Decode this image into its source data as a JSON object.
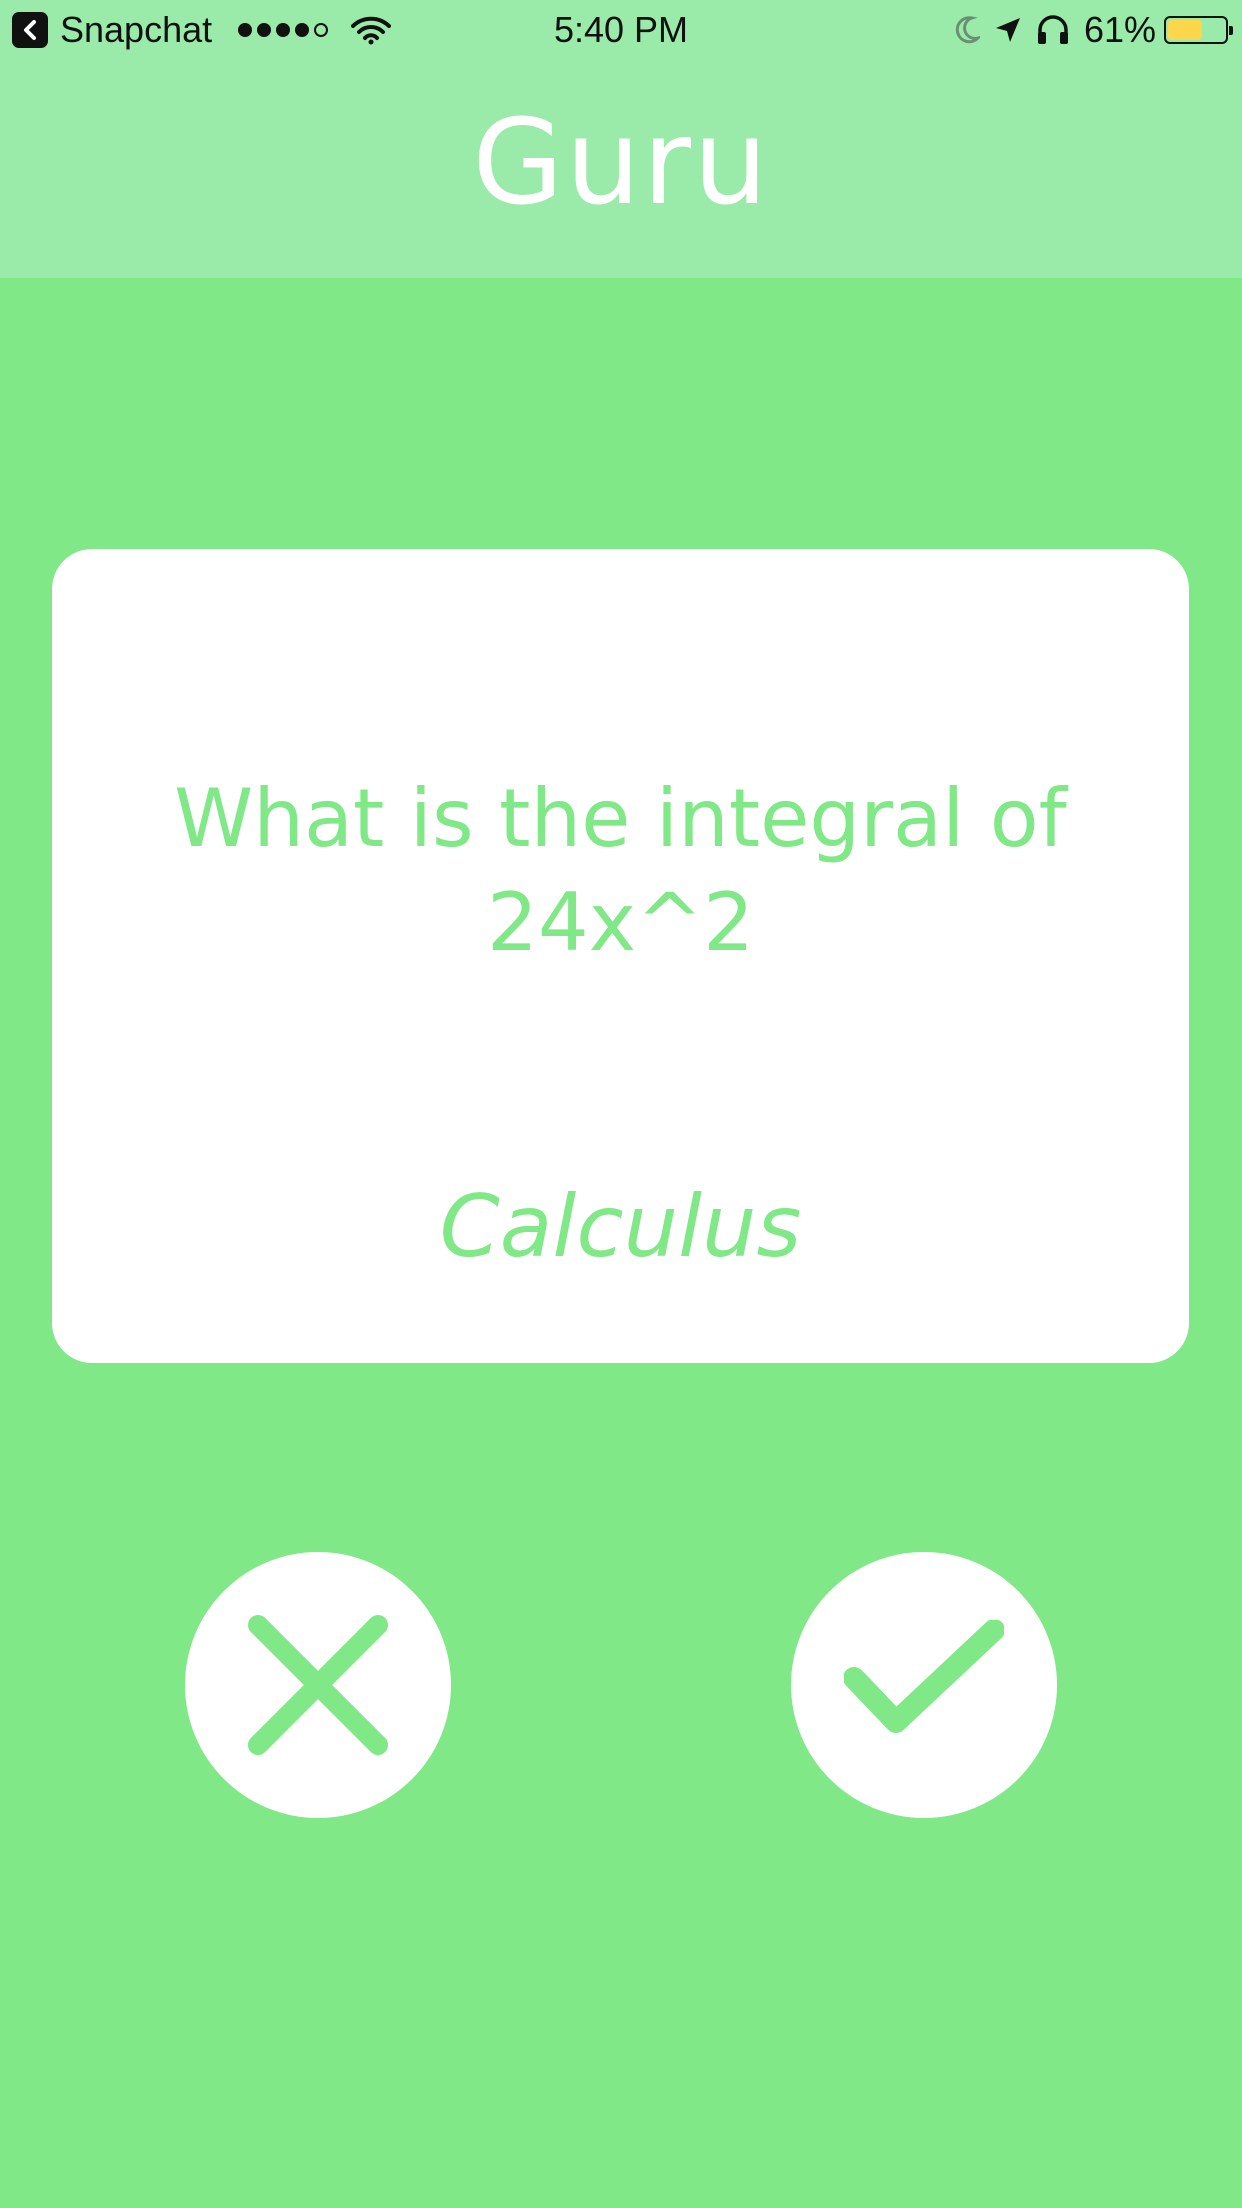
{
  "status_bar": {
    "back_app": "Snapchat",
    "signal_bars_filled": 4,
    "signal_bars_total": 5,
    "time": "5:40 PM",
    "battery_percent": "61%",
    "battery_level": 0.61,
    "battery_color": "#fcd74c",
    "icons": [
      "back-arrow-icon",
      "wifi-icon",
      "moon-icon",
      "location-arrow-icon",
      "headphones-icon",
      "battery-icon"
    ]
  },
  "header": {
    "title": "Guru",
    "background": "#9aeaaa"
  },
  "card": {
    "question": "What is the integral of 24x^2",
    "category": "Calculus"
  },
  "actions": {
    "reject_icon": "x-icon",
    "accept_icon": "checkmark-icon"
  },
  "colors": {
    "accent": "#80e886",
    "surface": "#ffffff"
  }
}
